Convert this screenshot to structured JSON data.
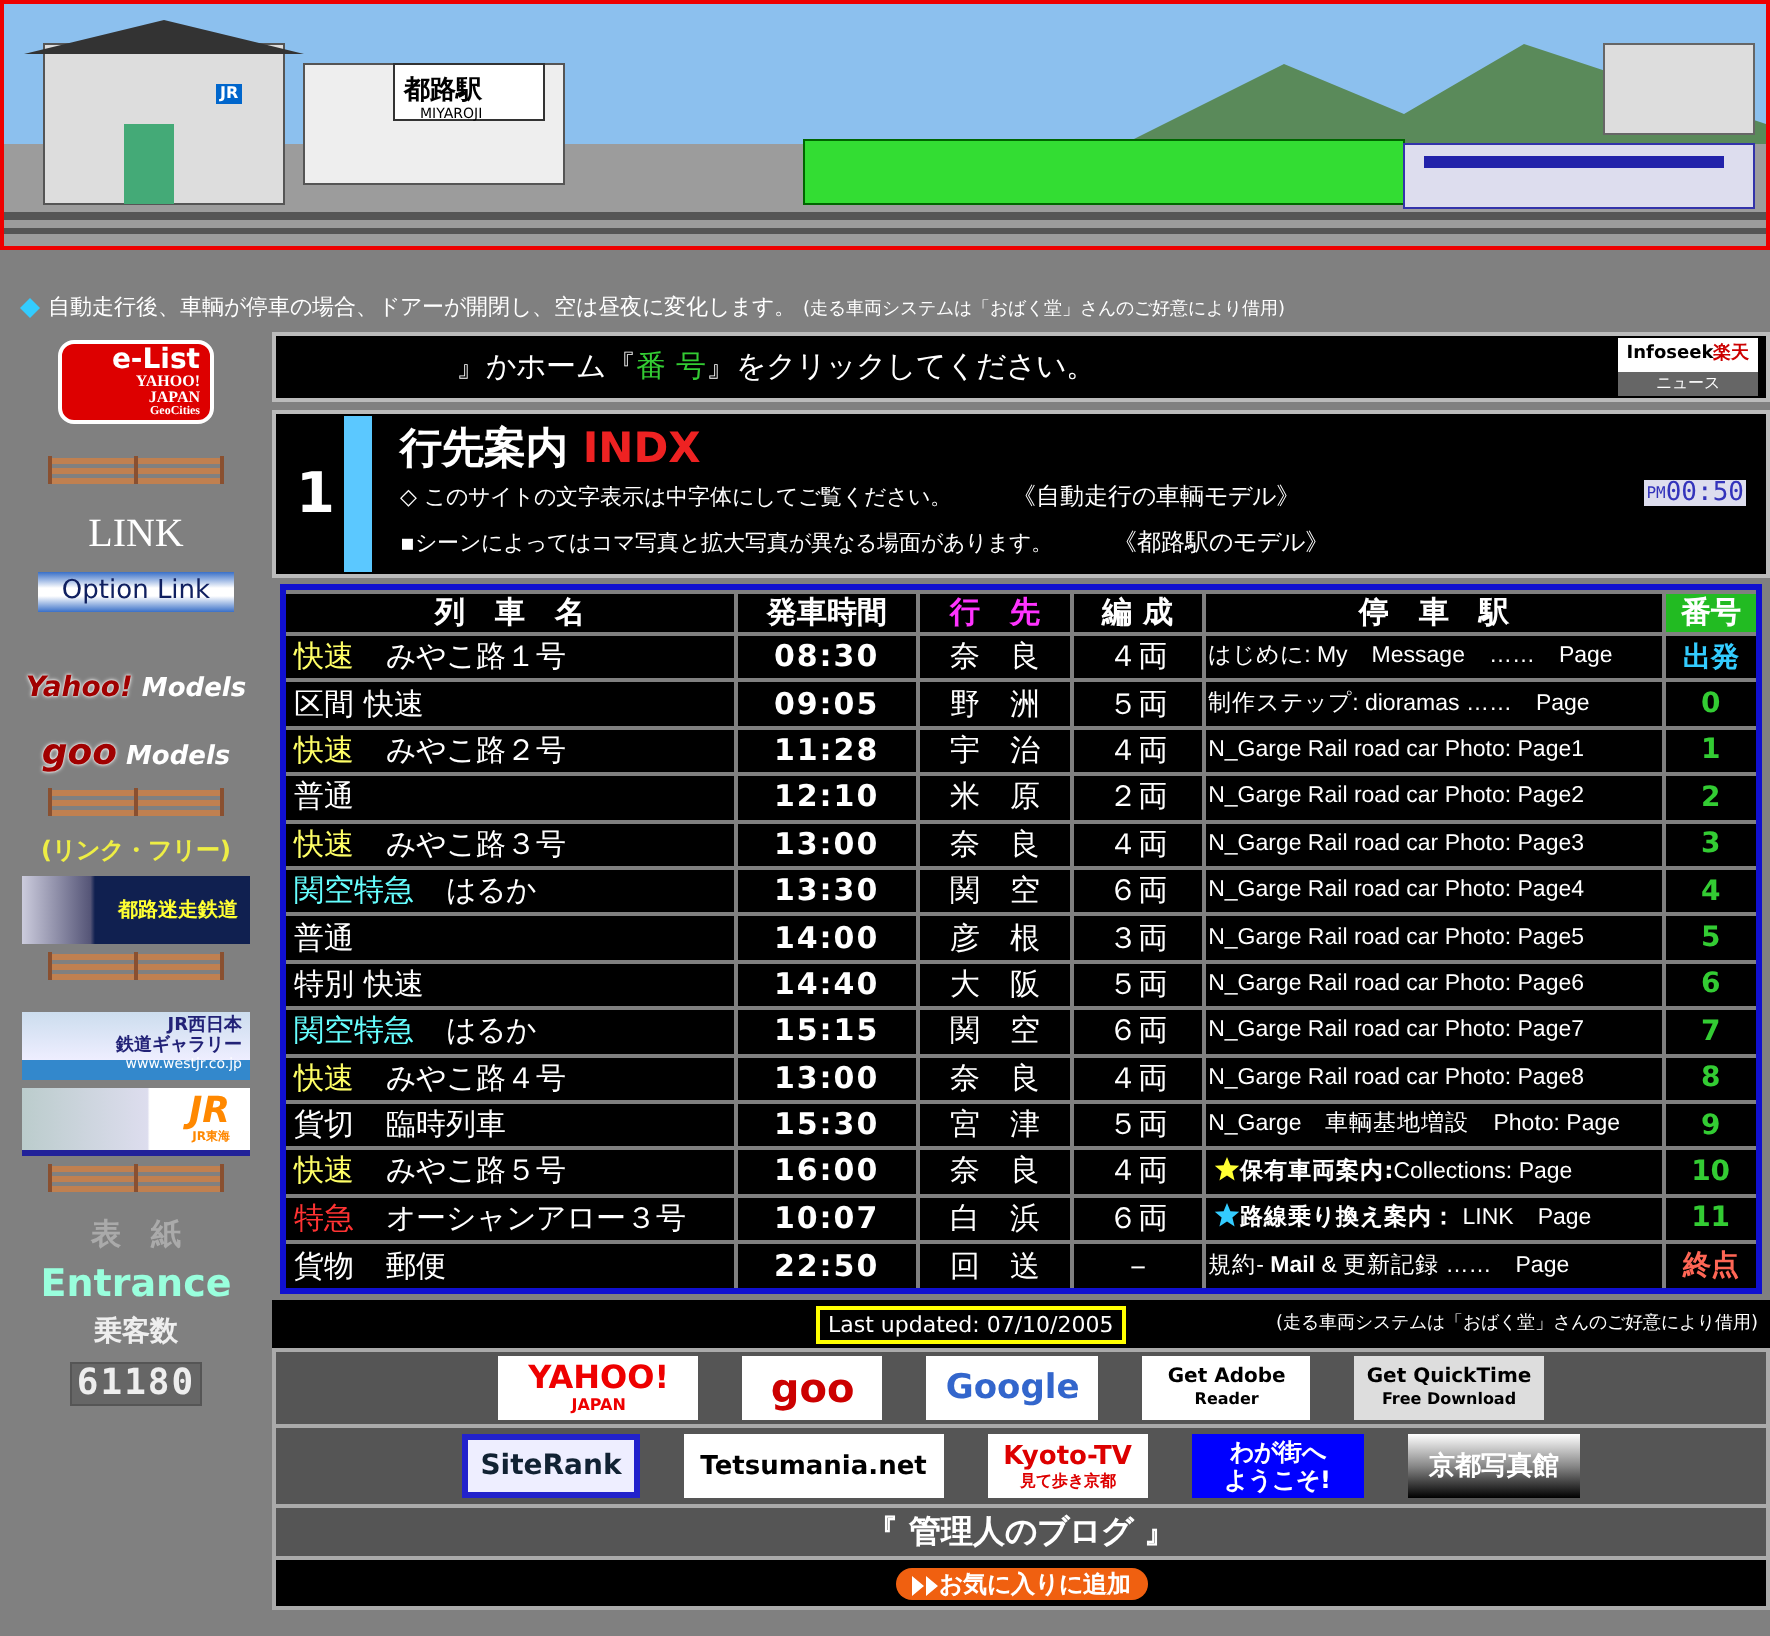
{
  "banner": {
    "station_name": "都路駅",
    "station_romaji": "MIYAROJI",
    "jr_mark": "JR"
  },
  "notice": {
    "text": "自動走行後、車輌が停車の場合、ドアーが開閉し、空は昼夜に変化します。",
    "credit": "(走る車両システムは「おばく堂」さんのご好意により借用)"
  },
  "sidebar": {
    "elist_logo": {
      "title": "e-List",
      "sub": "YAHOO!",
      "sub2": "JAPAN",
      "sub3": "GeoCities"
    },
    "link_heading": "LINK",
    "option_link": "Option Link",
    "models": [
      {
        "brand": "Yahoo!",
        "label": "Models"
      },
      {
        "brand": "goo",
        "label": "Models"
      }
    ],
    "link_free": "(リンク・フリー)",
    "banners": [
      {
        "kind": "miyaroji",
        "text": "都路迷走鉄道"
      },
      {
        "kind": "westjr",
        "text": "JR西日本",
        "text2": "鉄道ギャラリー",
        "url": "www.westjr.co.jp"
      },
      {
        "kind": "jr",
        "text": "JR",
        "text2": "JR東海"
      }
    ],
    "cover": "表　紙",
    "entrance": "Entrance",
    "visitors_label": "乗客数",
    "visitors": "61180"
  },
  "prompt": {
    "before": "』かホーム『",
    "highlight": "番 号",
    "after": "』をクリックしてください。",
    "news_logo": {
      "brand": "Infoseek",
      "brand2": "楽天",
      "label": "ニュース"
    }
  },
  "title_block": {
    "number": "1",
    "title": "行先案内",
    "title_en": "INDX",
    "line1": "◇ このサイトの文字表示は中字体にしてご覧ください。",
    "link1": "《自動走行の車輌モデル》",
    "line2": "▪シーンによってはコマ写真と拡大写真が異なる場面があります。",
    "link2": "《都路駅のモデル》",
    "clock": {
      "ampm": "PM",
      "time": "00:50"
    }
  },
  "table": {
    "columns": [
      "列　車　名",
      "発車時間",
      "行　先",
      "編 成",
      "停　車　駅",
      "番号"
    ],
    "rows": [
      {
        "type": {
          "text": "快速",
          "color": "#ffff66"
        },
        "name": "みやこ路１号",
        "time": "08:30",
        "dest": "奈　良",
        "cars": "４両",
        "stop": {
          "text": "はじめに: My　Message　……　Page"
        },
        "number": {
          "text": "出発",
          "color": "#33ccff"
        }
      },
      {
        "type": {
          "text": "区間 快速",
          "color": "#ffffff"
        },
        "time": "09:05",
        "dest": "野　洲",
        "cars": "５両",
        "stop": {
          "text": "制作ステップ: dioramas ……　Page"
        },
        "number": {
          "text": "0",
          "color": "#33cc33"
        }
      },
      {
        "type": {
          "text": "快速",
          "color": "#ffff66"
        },
        "name": "みやこ路２号",
        "time": "11:28",
        "dest": "宇　治",
        "cars": "４両",
        "stop": {
          "text": "N_Garge Rail road car Photo: Page1"
        },
        "number": {
          "text": "1",
          "color": "#33cc33"
        }
      },
      {
        "type": {
          "text": "普通",
          "color": "#ffffff"
        },
        "time": "12:10",
        "dest": "米　原",
        "cars": "２両",
        "stop": {
          "text": "N_Garge Rail road car Photo: Page2"
        },
        "number": {
          "text": "2",
          "color": "#33cc33"
        }
      },
      {
        "type": {
          "text": "快速",
          "color": "#ffff66"
        },
        "name": "みやこ路３号",
        "time": "13:00",
        "dest": "奈　良",
        "cars": "４両",
        "stop": {
          "text": "N_Garge Rail road car Photo: Page3"
        },
        "number": {
          "text": "3",
          "color": "#33cc33"
        }
      },
      {
        "type": {
          "text": "関空特急",
          "color": "#66ffff"
        },
        "name": "はるか",
        "time": "13:30",
        "dest": "関　空",
        "cars": "６両",
        "stop": {
          "text": "N_Garge Rail road car Photo: Page4"
        },
        "number": {
          "text": "4",
          "color": "#33cc33"
        }
      },
      {
        "type": {
          "text": "普通",
          "color": "#ffffff"
        },
        "time": "14:00",
        "dest": "彦　根",
        "cars": "３両",
        "stop": {
          "text": "N_Garge Rail road car Photo: Page5"
        },
        "number": {
          "text": "5",
          "color": "#33cc33"
        }
      },
      {
        "type": {
          "text": "特別 快速",
          "color": "#ffffff"
        },
        "time": "14:40",
        "dest": "大　阪",
        "cars": "５両",
        "stop": {
          "text": "N_Garge Rail road car Photo: Page6"
        },
        "number": {
          "text": "6",
          "color": "#33cc33"
        }
      },
      {
        "type": {
          "text": "関空特急",
          "color": "#66ffff"
        },
        "name": "はるか",
        "time": "15:15",
        "dest": "関　空",
        "cars": "６両",
        "stop": {
          "text": "N_Garge Rail road car Photo: Page7"
        },
        "number": {
          "text": "7",
          "color": "#33cc33"
        }
      },
      {
        "type": {
          "text": "快速",
          "color": "#ffff66"
        },
        "name": "みやこ路４号",
        "time": "13:00",
        "dest": "奈　良",
        "cars": "４両",
        "stop": {
          "text": "N_Garge Rail road car Photo: Page8"
        },
        "number": {
          "text": "8",
          "color": "#33cc33"
        }
      },
      {
        "type": {
          "text": "貨切",
          "color": "#ffffff"
        },
        "name": "臨時列車",
        "time": "15:30",
        "dest": "宮　津",
        "cars": "５両",
        "stop": {
          "text": "N_Garge　車輌基地増設　Photo: Page"
        },
        "number": {
          "text": "9",
          "color": "#33cc33"
        }
      },
      {
        "type": {
          "text": "快速",
          "color": "#ffff66"
        },
        "name": "みやこ路５号",
        "time": "16:00",
        "dest": "奈　良",
        "cars": "４両",
        "stop": {
          "text": "**保有車両案内:**Collections: Page",
          "star": {
            "color": "#ffff33"
          }
        },
        "number": {
          "text": "10",
          "color": "#33cc33"
        }
      },
      {
        "type": {
          "text": "特急",
          "color": "#ff3333"
        },
        "name": "オーシャンアロー３号",
        "time": "10:07",
        "dest": "白　浜",
        "cars": "６両",
        "stop": {
          "text": "**路線乗り換え案内：** LINK　Page",
          "star": {
            "color": "#33ccff"
          }
        },
        "number": {
          "text": "11",
          "color": "#33cc33"
        }
      },
      {
        "type": {
          "text": "貨物",
          "color": "#ffffff"
        },
        "name": "郵便",
        "time": "22:50",
        "dest": "回　送",
        "cars": "－",
        "stop": {
          "text": "規約-",
          "link": "Mail",
          "rest": "& 更新記録 ……　Page"
        },
        "number": {
          "text": "終点",
          "color": "#ff6655"
        }
      }
    ]
  },
  "footer": {
    "last_updated": "Last updated: 07/10/2005",
    "credit": "(走る車両システムは「おばく堂」さんのご好意により借用)",
    "logo_rows": [
      [
        {
          "kind": "yahoo",
          "text": "YAHOO!",
          "text2": "JAPAN"
        },
        {
          "kind": "goo",
          "text": "goo"
        },
        {
          "kind": "google",
          "text": "Google"
        },
        {
          "kind": "adobe",
          "text": "Get Adobe",
          "text2": "Reader"
        },
        {
          "kind": "quicktime",
          "text": "Get QuickTime",
          "text2": "Free Download"
        }
      ],
      [
        {
          "kind": "siterank",
          "text": "SiteRank"
        },
        {
          "kind": "tetsumania",
          "text": "Tetsumania.net"
        },
        {
          "kind": "kyototv",
          "text": "Kyoto-TV",
          "text2": "見て歩き京都"
        },
        {
          "kind": "wagamachi",
          "text": "わが街へ",
          "text2": "ようこそ!"
        },
        {
          "kind": "photo",
          "text": "京都写真館"
        }
      ]
    ],
    "blog": "『 管理人のブログ 』",
    "favorite": "お気に入りに追加"
  }
}
